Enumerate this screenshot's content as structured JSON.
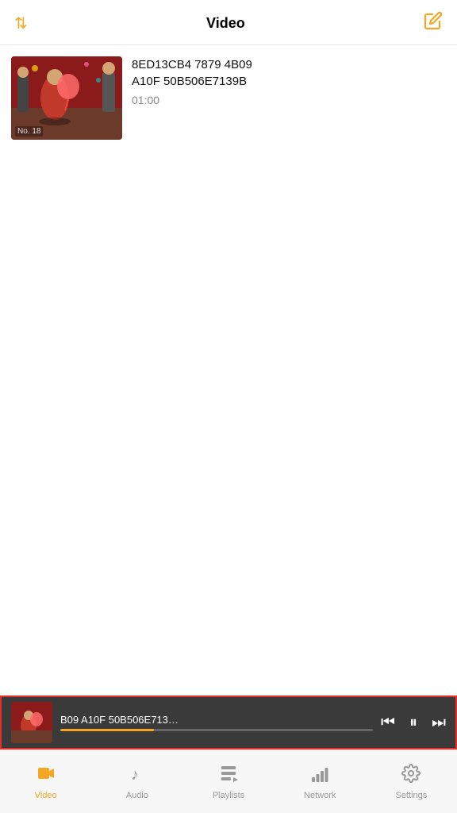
{
  "header": {
    "title": "Video",
    "sort_icon": "sort-icon",
    "edit_icon": "edit-icon"
  },
  "video_list": [
    {
      "id": "v1",
      "title": "8ED13CB4 7879 4B09\nA10F 50B506E7139B",
      "duration": "01:00",
      "thumbnail_label": "No. 18"
    }
  ],
  "mini_player": {
    "title": "B09 A10F 50B506E713…",
    "progress_percent": 30
  },
  "bottom_nav": {
    "items": [
      {
        "id": "video",
        "label": "Video",
        "active": true
      },
      {
        "id": "audio",
        "label": "Audio",
        "active": false
      },
      {
        "id": "playlists",
        "label": "Playlists",
        "active": false
      },
      {
        "id": "network",
        "label": "Network",
        "active": false
      },
      {
        "id": "settings",
        "label": "Settings",
        "active": false
      }
    ]
  }
}
